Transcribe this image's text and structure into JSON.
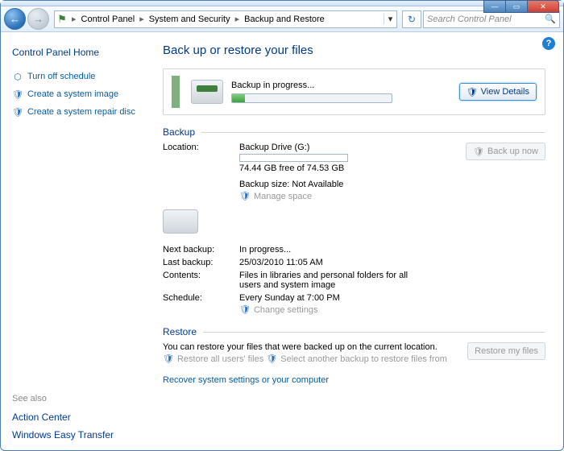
{
  "breadcrumb": {
    "icon": "control-panel-icon",
    "items": [
      "Control Panel",
      "System and Security",
      "Backup and Restore"
    ],
    "sep": "▸"
  },
  "search": {
    "placeholder": "Search Control Panel"
  },
  "sidebar": {
    "home": "Control Panel Home",
    "links": [
      {
        "label": "Turn off schedule",
        "icon": "schedule-icon"
      },
      {
        "label": "Create a system image",
        "icon": "shield-icon"
      },
      {
        "label": "Create a system repair disc",
        "icon": "shield-icon"
      }
    ],
    "see_also": "See also",
    "alt": [
      "Action Center",
      "Windows Easy Transfer"
    ]
  },
  "page": {
    "title": "Back up or restore your files"
  },
  "progress": {
    "text": "Backup in progress...",
    "button": "View Details"
  },
  "backup": {
    "heading": "Backup",
    "location_label": "Location:",
    "location_value": "Backup Drive (G:)",
    "free_space": "74.44 GB free of 74.53 GB",
    "size": "Backup size: Not Available",
    "manage": "Manage space",
    "backup_now": "Back up now",
    "next_label": "Next backup:",
    "next_value": "In progress...",
    "last_label": "Last backup:",
    "last_value": "25/03/2010 11:05 AM",
    "contents_label": "Contents:",
    "contents_value": "Files in libraries and personal folders for all users and system image",
    "schedule_label": "Schedule:",
    "schedule_value": "Every Sunday at 7:00 PM",
    "change": "Change settings"
  },
  "restore": {
    "heading": "Restore",
    "text": "You can restore your files that were backed up on the current location.",
    "restore_all": "Restore all users' files",
    "select_another": "Select another backup to restore files from",
    "restore_btn": "Restore my files",
    "recover": "Recover system settings or your computer"
  }
}
